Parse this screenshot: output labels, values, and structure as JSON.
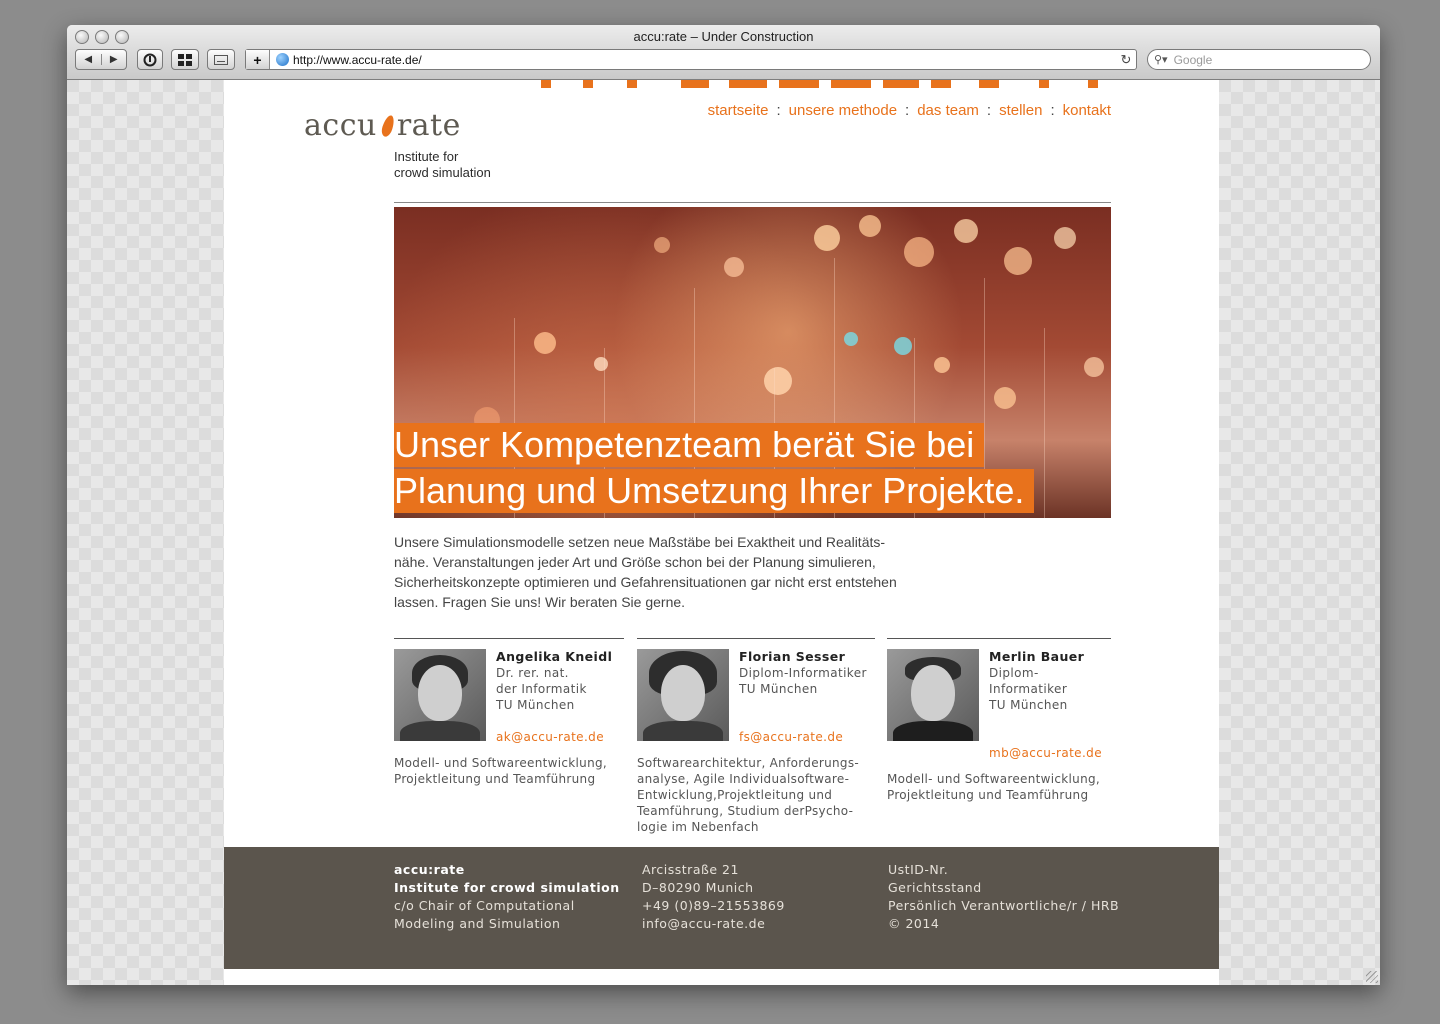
{
  "window": {
    "title": "accu:rate – Under Construction"
  },
  "toolbar": {
    "back_icon": "◀",
    "forward_icon": "▶",
    "add_icon": "+",
    "reload_icon": "↻",
    "url": "http://www.accu-rate.de/",
    "search_placeholder": "Google"
  },
  "brand": {
    "name_left": "accu",
    "name_right": "rate",
    "subtitle_line1": "Institute for",
    "subtitle_line2": "crowd simulation",
    "accent_color": "#e8721c"
  },
  "nav": {
    "items": [
      {
        "label": "startseite"
      },
      {
        "label": "unsere methode"
      },
      {
        "label": "das team"
      },
      {
        "label": "stellen"
      },
      {
        "label": "kontakt"
      }
    ],
    "separator": ":"
  },
  "hero": {
    "line1": "Unser Kompetenzteam berät Sie bei",
    "line2": "Planung und Umsetzung Ihrer Projekte."
  },
  "intro": {
    "text": "Unsere Simulationsmodelle setzen neue Maßstäbe bei Exaktheit und Realitäts-nähe. Veranstaltungen jeder Art und Größe schon bei der Planung simulieren, Sicherheitskonzepte optimieren und Gefahrensituationen gar nicht erst entstehen lassen. Fragen Sie uns! Wir beraten Sie gerne."
  },
  "team": [
    {
      "name": "Angelika Kneidl",
      "title_lines": [
        "Dr. rer. nat.",
        "der Informatik",
        "TU München"
      ],
      "email": "ak@accu-rate.de",
      "desc": [
        "Modell- und Softwareentwicklung,",
        "Projektleitung und Teamführung"
      ]
    },
    {
      "name": "Florian Sesser",
      "title_lines": [
        "Diplom-Informatiker",
        "TU München"
      ],
      "email": "fs@accu-rate.de",
      "desc": [
        "Softwarearchitektur, Anforderungs-",
        "analyse, Agile Individualsoftware-",
        "Entwicklung,Projektleitung und",
        "Teamführung, Studium derPsycho-",
        "logie im Nebenfach"
      ]
    },
    {
      "name": "Merlin Bauer",
      "title_lines": [
        "Diplom-Informatiker",
        "TU München"
      ],
      "email": "mb@accu-rate.de",
      "desc": [
        "Modell- und Softwareentwicklung,",
        "Projektleitung und Teamführung"
      ]
    }
  ],
  "footer": {
    "col1": [
      "accu:rate",
      "Institute for crowd simulation",
      "c/o Chair of Computational",
      "Modeling and Simulation"
    ],
    "col2": [
      "Arcisstraße 21",
      "D–80290 Munich",
      "+49 (0)89–21553869",
      "info@accu-rate.de"
    ],
    "col3": [
      "UstID-Nr.",
      "Gerichtsstand",
      "Persönlich Verantwortliche/r / HRB",
      "© 2014"
    ]
  }
}
